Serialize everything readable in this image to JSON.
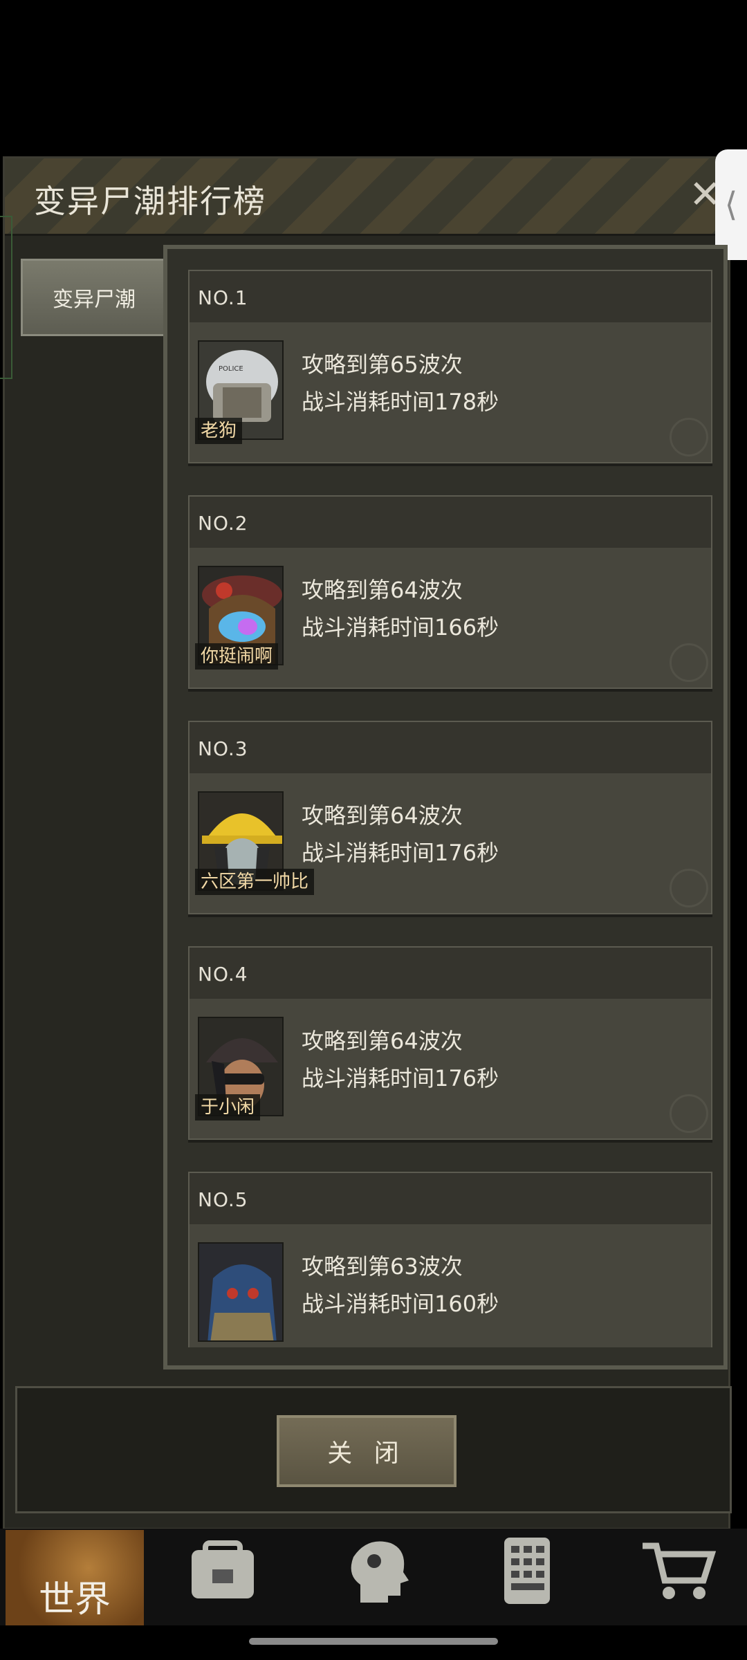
{
  "dialog": {
    "title": "变异尸潮排行榜",
    "close_icon": "close-icon",
    "tab": "变异尸潮",
    "close_button": "关 闭"
  },
  "ranking": [
    {
      "rank": "NO.1",
      "name": "老狗",
      "line1": "攻略到第65波次",
      "line2": "战斗消耗时间178秒"
    },
    {
      "rank": "NO.2",
      "name": "你挺闹啊",
      "line1": "攻略到第64波次",
      "line2": "战斗消耗时间166秒"
    },
    {
      "rank": "NO.3",
      "name": "六区第一帅比",
      "line1": "攻略到第64波次",
      "line2": "战斗消耗时间176秒"
    },
    {
      "rank": "NO.4",
      "name": "于小闲",
      "line1": "攻略到第64波次",
      "line2": "战斗消耗时间176秒"
    },
    {
      "rank": "NO.5",
      "name": "",
      "line1": "攻略到第63波次",
      "line2": "战斗消耗时间160秒"
    }
  ],
  "nav": {
    "world_label": "世界",
    "icons": [
      "backpack-icon",
      "head-icon",
      "phone-keypad-icon",
      "cart-icon"
    ]
  },
  "colors": {
    "background": "#000000",
    "panel": "#272721",
    "entry": "#47463d",
    "accent": "#b47e3a"
  }
}
